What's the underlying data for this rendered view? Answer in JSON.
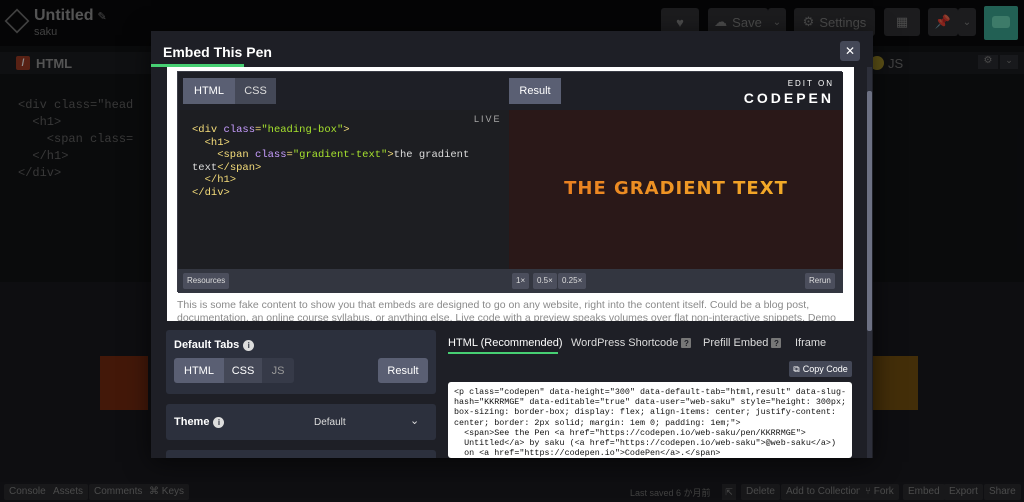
{
  "header": {
    "title": "Untitled",
    "author": "saku",
    "save_label": "Save",
    "settings_label": "Settings"
  },
  "editor": {
    "html_tab": "HTML",
    "js_tab": "JS",
    "code_lines": [
      "<div class=\"head",
      "  <h1>",
      "    <span class=",
      "  </h1>",
      "</div>"
    ]
  },
  "modal": {
    "title": "Embed This Pen",
    "close_icon": "close-icon",
    "demo": {
      "tabs": [
        "HTML",
        "CSS"
      ],
      "result_label": "Result",
      "edit_on": "EDIT ON",
      "brand": "CODEPEN",
      "live_label": "LIVE",
      "code": {
        "l1_open": "<div ",
        "l1_attr": "class",
        "l1_eq": "=",
        "l1_str": "\"heading-box\"",
        "l1_close": ">",
        "l2": "  <h1>",
        "l3_open": "    <span ",
        "l3_attr": "class",
        "l3_eq": "=",
        "l3_str": "\"gradient-text\"",
        "l3_close": ">",
        "l3_text": "the gradient",
        "l4_text": "text",
        "l4_tag": "</span>",
        "l5": "  </h1>",
        "l6": "</div>"
      },
      "result_text": "THE GRADIENT TEXT",
      "resources_label": "Resources",
      "zoom": [
        "1×",
        "0.5×",
        "0.25×"
      ],
      "rerun_label": "Rerun",
      "filler_text": "This is some fake content to show you that embeds are designed to go on any website, right into the content itself. Could be a blog post, documentation, an online course syllabus, or anything else. Live code with a preview speaks volumes over flat non-interactive snippets. Demo"
    },
    "default_tabs": {
      "label": "Default Tabs",
      "tabs": [
        "HTML",
        "CSS",
        "JS"
      ],
      "result_label": "Result"
    },
    "theme": {
      "label": "Theme",
      "value": "Default"
    },
    "embed_types": [
      "HTML (Recommended)",
      "WordPress Shortcode",
      "Prefill Embed",
      "Iframe"
    ],
    "copy_label": "Copy Code",
    "embed_code": "<p class=\"codepen\" data-height=\"300\" data-default-tab=\"html,result\" data-slug-hash=\"KKRRMGE\" data-editable=\"true\" data-user=\"web-saku\" style=\"height: 300px; box-sizing: border-box; display: flex; align-items: center; justify-content: center; border: 2px solid; margin: 1em 0; padding: 1em;\">\n  <span>See the Pen <a href=\"https://codepen.io/web-saku/pen/KKRRMGE\">\n  Untitled</a> by saku (<a href=\"https://codepen.io/web-saku\">@web-saku</a>)\n  on <a href=\"https://codepen.io\">CodePen</a>.</span>"
  },
  "footer": {
    "left": [
      "Console",
      "Assets",
      "Comments",
      "⌘ Keys"
    ],
    "saved": "Last saved 6 か月前",
    "right": [
      "Delete",
      "Add to Collection",
      "Fork",
      "Embed",
      "Export",
      "Share"
    ]
  },
  "colors": {
    "accent": "#47cf73",
    "gradient_start": "#e8761f",
    "gradient_end": "#f5b62a"
  }
}
